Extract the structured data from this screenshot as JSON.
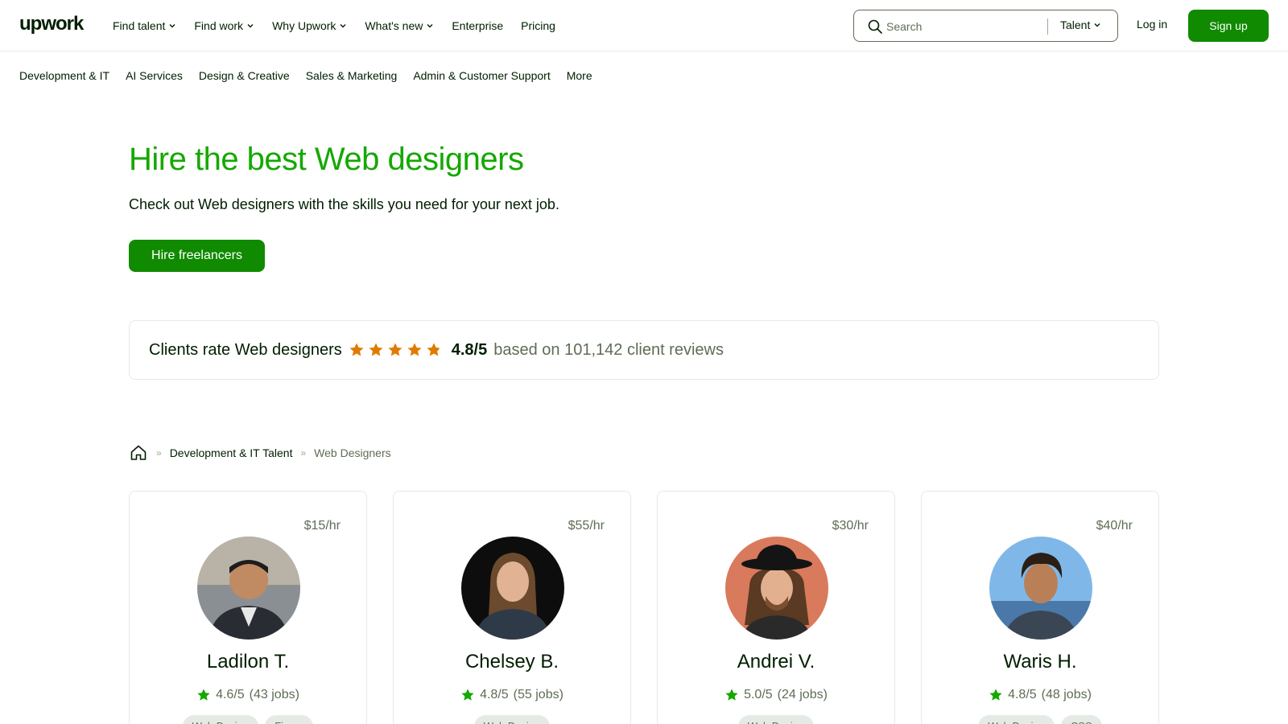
{
  "header": {
    "logo": "upwork",
    "nav": [
      "Find talent",
      "Find work",
      "Why Upwork",
      "What's new",
      "Enterprise",
      "Pricing"
    ],
    "search": {
      "placeholder": "Search",
      "scope": "Talent"
    },
    "login": "Log in",
    "signup": "Sign up"
  },
  "categories": [
    "Development & IT",
    "AI Services",
    "Design & Creative",
    "Sales & Marketing",
    "Admin & Customer Support",
    "More"
  ],
  "hero": {
    "title": "Hire the best Web designers",
    "subtitle": "Check out Web designers with the skills you need for your next job.",
    "button": "Hire freelancers"
  },
  "rating": {
    "label": "Clients rate Web designers",
    "score": "4.8/5",
    "based": "based on 101,142 client reviews",
    "stars": 4.8
  },
  "breadcrumb": {
    "parent": "Development & IT Talent",
    "current": "Web Designers"
  },
  "colors": {
    "brand": "#14a800",
    "button": "#108a00",
    "star_orange": "#e07b00",
    "star_green": "#14a800"
  },
  "freelancers": [
    {
      "rate": "$15/hr",
      "name": "Ladilon T.",
      "score": "4.6/5",
      "jobs": "(43 jobs)",
      "tags": [
        "Web Design",
        "Figma"
      ]
    },
    {
      "rate": "$55/hr",
      "name": "Chelsey B.",
      "score": "4.8/5",
      "jobs": "(55 jobs)",
      "tags": [
        "Web Design"
      ]
    },
    {
      "rate": "$30/hr",
      "name": "Andrei V.",
      "score": "5.0/5",
      "jobs": "(24 jobs)",
      "tags": [
        "Web Design"
      ]
    },
    {
      "rate": "$40/hr",
      "name": "Waris H.",
      "score": "4.8/5",
      "jobs": "(48 jobs)",
      "tags": [
        "Web Design",
        "CSS"
      ]
    }
  ]
}
